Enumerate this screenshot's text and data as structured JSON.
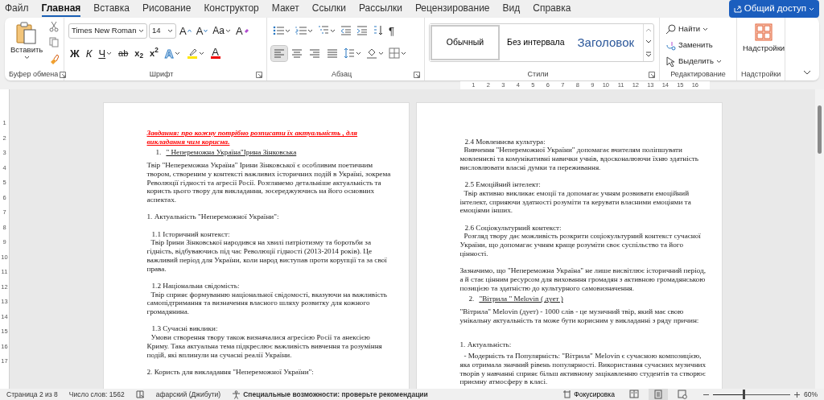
{
  "menu_tabs": [
    {
      "label": "Файл",
      "selected": false
    },
    {
      "label": "Главная",
      "selected": true
    },
    {
      "label": "Вставка",
      "selected": false
    },
    {
      "label": "Рисование",
      "selected": false
    },
    {
      "label": "Конструктор",
      "selected": false
    },
    {
      "label": "Макет",
      "selected": false
    },
    {
      "label": "Ссылки",
      "selected": false
    },
    {
      "label": "Рассылки",
      "selected": false
    },
    {
      "label": "Рецензирование",
      "selected": false
    },
    {
      "label": "Вид",
      "selected": false
    },
    {
      "label": "Справка",
      "selected": false
    }
  ],
  "share_button": {
    "label": "Общий доступ"
  },
  "clipboard": {
    "label": "Буфер обмена",
    "paste": "Вставить"
  },
  "font": {
    "label": "Шрифт",
    "font_name": "Times New Roman",
    "font_size": "14",
    "size_buttons": [
      {
        "kind": "grow",
        "label": "A"
      },
      {
        "kind": "shrink",
        "label": "A"
      }
    ],
    "case_button": "Aa",
    "clear_button": "A",
    "format_buttons": [
      {
        "kind": "bold",
        "label": "Ж"
      },
      {
        "kind": "italic",
        "label": "К"
      },
      {
        "kind": "underline",
        "label": "Ч"
      },
      {
        "kind": "strike",
        "label": "ab"
      },
      {
        "kind": "subscript",
        "label": "x$_{2}$"
      },
      {
        "kind": "superscript",
        "label": "x$^{2}$"
      }
    ],
    "effects_button": "A",
    "font_color_button": "A"
  },
  "paragraph": {
    "label": "Абзац",
    "pilcrow": "¶",
    "alignments": [
      {
        "kind": "left",
        "selected": true
      },
      {
        "kind": "center",
        "selected": false
      },
      {
        "kind": "right",
        "selected": false
      },
      {
        "kind": "justify",
        "selected": false
      }
    ]
  },
  "styles": {
    "label": "Стили",
    "items": [
      {
        "kind": "normal",
        "label": "Обычный",
        "selected": true
      },
      {
        "kind": "no-spacing",
        "label": "Без интервала",
        "selected": false
      },
      {
        "kind": "heading",
        "label": "Заголовок",
        "selected": false
      }
    ]
  },
  "editing": {
    "label": "Редактирование",
    "items": [
      {
        "kind": "find",
        "label": "Найти"
      },
      {
        "kind": "replace",
        "label": "Заменить"
      },
      {
        "kind": "select",
        "label": "Выделить"
      }
    ]
  },
  "addins": {
    "label": "Надстройки",
    "button": "Надстройки"
  },
  "ruler": {
    "marks": [
      "1",
      "2",
      "3",
      "4",
      "5",
      "6",
      "7",
      "8",
      "9",
      "10",
      "11",
      "12",
      "13",
      "14",
      "15",
      "16"
    ]
  },
  "vertical_ruler": {
    "marks": [
      "1",
      "2",
      "3",
      "4",
      "5",
      "6",
      "7",
      "8",
      "9",
      "10",
      "11",
      "12",
      "13",
      "14",
      "15",
      "16",
      "17"
    ]
  },
  "pages": [
    {
      "paragraphs": [
        {
          "kind": "task",
          "text": "Завдання:  про кожну потрібно розписати їх актуальність , для викладання чим корисна."
        },
        {
          "kind": "numbered",
          "number": "1.",
          "text": "\" Непереможна Україна\"Ірина Зінковська"
        },
        {
          "kind": "body",
          "text": "Твір \"Непереможна Україна\" Ірини Зінковської є особливим поетичним твором, створеним у контексті важливих історичних подій в Україні, зокрема Революції гідності та агресії Росії. Розглянемо детальніше актуальність та користь цього твору для викладання, зосереджуючись на його основних аспектах."
        },
        {
          "kind": "section",
          "text": "1. Актуальність \"Непереможної України\":"
        },
        {
          "kind": "sub-heading",
          "text": "1.1 Історичний контекст:"
        },
        {
          "kind": "sub-body",
          "text": "Твір Ірини Зінковської народився на хвилі патріотизму та боротьби за гідність, відбуваючись під час Революції гідності (2013-2014 років). Це важливий період для України, коли народ виступав проти корупції та за свої права."
        },
        {
          "kind": "sub-heading",
          "text": "1.2 Національна свідомість:"
        },
        {
          "kind": "sub-body",
          "text": "Твір сприяє формуванню національної свідомості, вказуючи на важливість самопідтримання та визначення власного шляху розвитку для кожного громадянина."
        },
        {
          "kind": "sub-heading",
          "text": "1.3 Сучасні виклики:"
        },
        {
          "kind": "sub-body",
          "text": "Умови створення твору також визначалися агресією Росії та анексією Криму. Така актуальна тема підкреслює важливість вивчення та розуміння подій, які вплинули на сучасні реалії України."
        },
        {
          "kind": "section",
          "text": "2. Користь для викладання \"Непереможної України\":"
        }
      ]
    },
    {
      "paragraphs": [
        {
          "kind": "sub-heading",
          "text": "2.4 Мовленнєва культура:"
        },
        {
          "kind": "sub-body",
          "text": "Вивчення \"Непереможної України\" допомагає вчителям поліпшувати мовленнєві та комунікативні навички учнів, вдосконалюючи їхню здатність висловлювати власні думки та переживання."
        },
        {
          "kind": "sub-heading",
          "text": "2.5 Емоційний інтелект:"
        },
        {
          "kind": "sub-body",
          "text": "Твір активно викликає емоції та допомагає учням розвивати емоційний інтелект, сприяючи здатності розуміти та керувати власними емоціями та емоціями інших."
        },
        {
          "kind": "sub-heading",
          "text": "2.6 Соціокультурний контекст:"
        },
        {
          "kind": "sub-body",
          "text": "Розгляд твору дає можливість розкрити соціокультурний контекст сучасної України, що допомагає учням краще розуміти своє суспільство та його цінності."
        },
        {
          "kind": "section",
          "text": "Зазначимо, що \"Непереможна Україна\" не лише висвітлює історичний період, а й стає цінним ресурсом для виховання громадян з активною громадянською позицією та здатністю до культурного самовизначення."
        },
        {
          "kind": "numbered",
          "number": "2.",
          "text": "\"Вітрила \" Melovin ( дует )"
        },
        {
          "kind": "body",
          "text": "\"Вітрила\" Melovin (дует) - 1000 слів - це музичний твір, який має свою унікальну актуальність та може бути корисним у викладанні з ряду причин:"
        },
        {
          "kind": "section-far",
          "text": "1. Актуальність:"
        },
        {
          "kind": "sub-body",
          "text": "- Модерність та Популярність: \"Вітрила\" Melovin є сучасною композицією, яка отримала значний рівень популярності. Використання сучасних музичних творів у навчанні сприяє більш активному зацікавленню студентів та створює приємну атмосферу в класі."
        }
      ]
    }
  ],
  "status_bar": {
    "page": "Страница 2 из 8",
    "words": "Число слов: 1562",
    "language": "афарский (Джибути)",
    "accessibility": "Специальные возможности: проверьте рекомендации",
    "focus": "Фокусировка",
    "views": [
      {
        "kind": "read",
        "selected": false
      },
      {
        "kind": "print",
        "selected": true
      },
      {
        "kind": "web",
        "selected": false
      }
    ],
    "zoom": {
      "level": 0.42,
      "reading": "60%"
    }
  }
}
